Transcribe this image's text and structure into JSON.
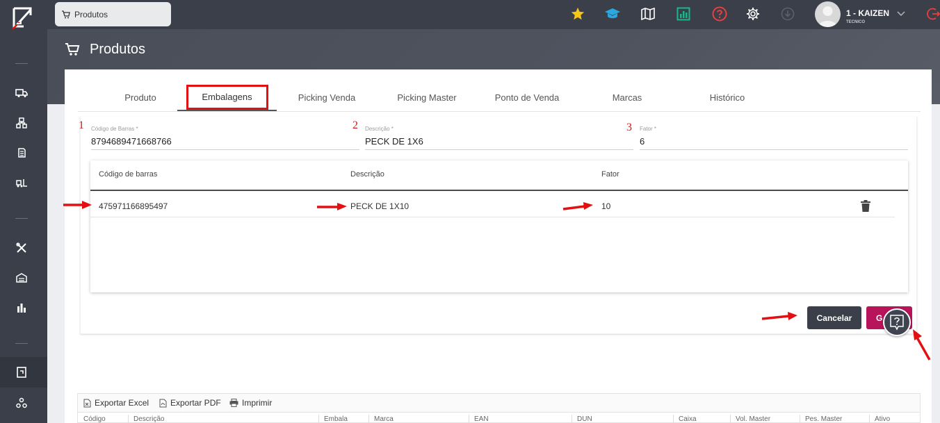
{
  "topbar": {
    "tab_label": "Produtos",
    "user_name": "1 - KAIZEN",
    "user_role": "TECNICO"
  },
  "page": {
    "title": "Produtos"
  },
  "tabs": [
    {
      "label": "Produto"
    },
    {
      "label": "Embalagens"
    },
    {
      "label": "Picking Venda"
    },
    {
      "label": "Picking Master"
    },
    {
      "label": "Ponto de Venda"
    },
    {
      "label": "Marcas"
    },
    {
      "label": "Histórico"
    }
  ],
  "form": {
    "barcode": {
      "label": "Código de Barras *",
      "value": "8794689471668766",
      "marker": "1"
    },
    "description": {
      "label": "Descrição *",
      "value": "PECK DE 1X6",
      "marker": "2"
    },
    "factor": {
      "label": "Fator *",
      "value": "6",
      "marker": "3"
    }
  },
  "table": {
    "headers": [
      "Código de barras",
      "Descrição",
      "Fator"
    ],
    "rows": [
      {
        "barcode": "475971166895497",
        "description": "PECK DE 1X10",
        "factor": "10"
      }
    ]
  },
  "buttons": {
    "cancel": "Cancelar",
    "save": "G"
  },
  "export": {
    "excel": "Exportar Excel",
    "pdf": "Exportar PDF",
    "print": "Imprimir"
  },
  "grid_headers": [
    "Código",
    "Descrição",
    "Embala",
    "Marca",
    "EAN",
    "DUN",
    "Caixa",
    "Vol. Master",
    "Pes. Master",
    "Ativo"
  ],
  "colors": {
    "sidebar": "#3b3f4a",
    "header_band": "#4f535e",
    "save_button": "#b8145c",
    "annotation_red": "#e21010",
    "star": "#f5c518",
    "graduation": "#2aa8e0",
    "chart_icon": "#1eb58a",
    "help_icon": "#e84040",
    "logout": "#e84040"
  }
}
